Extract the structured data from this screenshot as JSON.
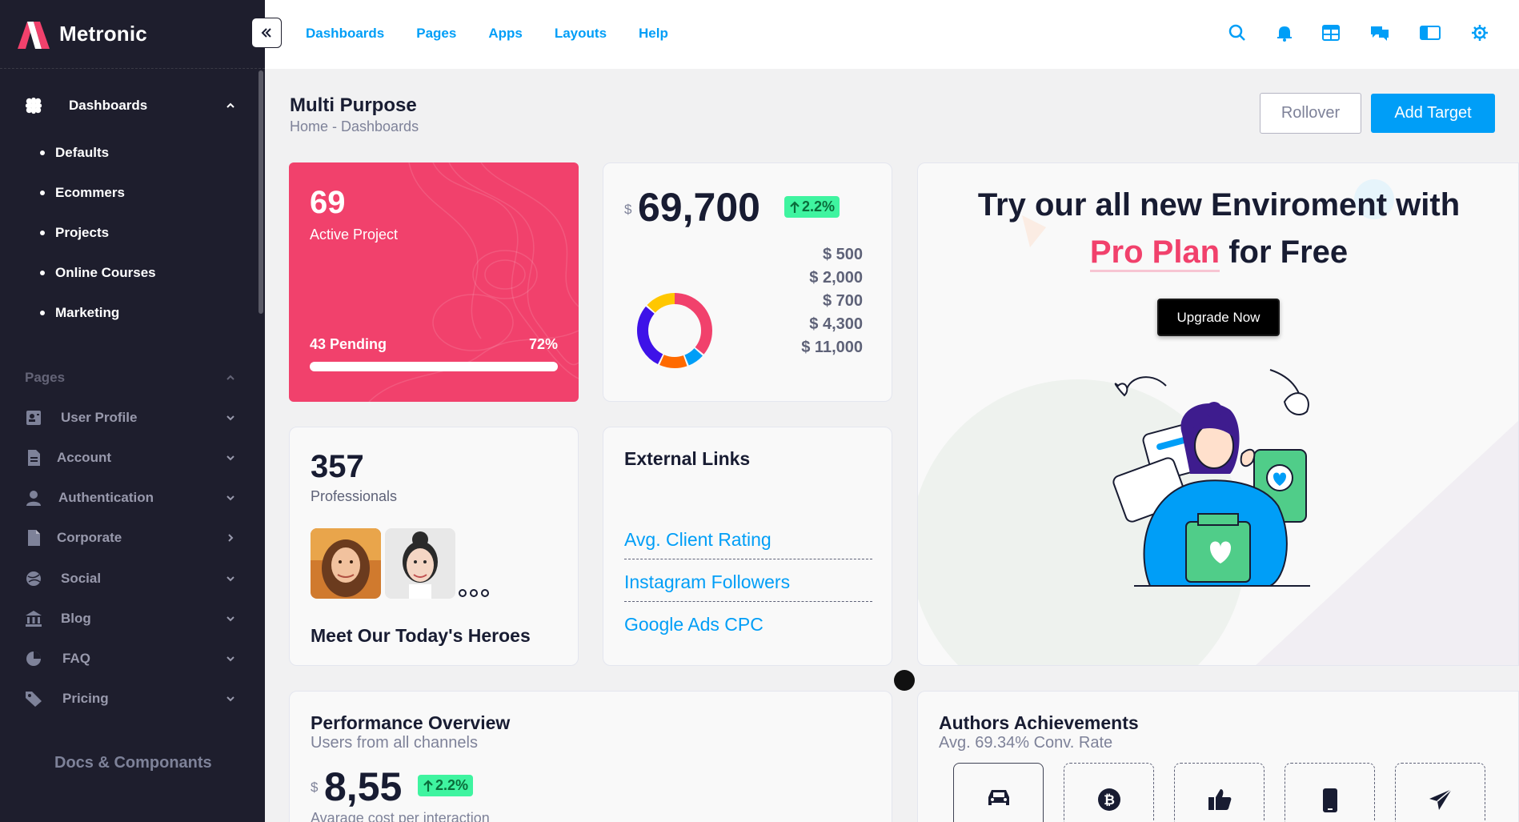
{
  "app": {
    "name": "Metronic"
  },
  "sidebar": {
    "dashboards_label": "Dashboards",
    "dashboard_items": [
      "Defaults",
      "Ecommers",
      "Projects",
      "Online Courses",
      "Marketing"
    ],
    "pages_section": "Pages",
    "pages_items": [
      {
        "label": "User Profile",
        "icon": "profile-icon"
      },
      {
        "label": "Account",
        "icon": "document-icon"
      },
      {
        "label": "Authentication",
        "icon": "user-icon"
      },
      {
        "label": "Corporate",
        "icon": "file-icon"
      },
      {
        "label": "Social",
        "icon": "globe-icon"
      },
      {
        "label": "Blog",
        "icon": "bank-icon"
      },
      {
        "label": "FAQ",
        "icon": "pie-icon"
      },
      {
        "label": "Pricing",
        "icon": "tag-icon"
      }
    ],
    "docs_label": "Docs & Componants"
  },
  "header": {
    "nav": [
      "Dashboards",
      "Pages",
      "Apps",
      "Layouts",
      "Help"
    ],
    "icons": [
      "search-icon",
      "bell-icon",
      "grid-icon",
      "chat-icon",
      "layout-icon",
      "settings-icon"
    ]
  },
  "page": {
    "title": "Multi Purpose",
    "breadcrumb": "Home - Dashboards",
    "rollover_label": "Rollover",
    "add_target_label": "Add Target"
  },
  "projects_card": {
    "value": "69",
    "label": "Active Project",
    "pending": "43 Pending",
    "percent": "72%",
    "progress": 0.72
  },
  "sales_card": {
    "currency": "$",
    "value": "69,700",
    "change": "2.2%",
    "values": [
      "$ 500",
      "$ 2,000",
      "$ 700",
      "$ 4,300",
      "$ 11,000"
    ],
    "donut_colors": [
      "#f1416c",
      "#009ef7",
      "#ff6a00",
      "#3e12e8",
      "#ffc700"
    ]
  },
  "promo": {
    "line1": "Try our all new Enviroment with",
    "highlight": "Pro Plan",
    "line2_rest": " for Free",
    "button": "Upgrade Now"
  },
  "heroes_card": {
    "value": "357",
    "label": "Professionals",
    "title": "Meet Our Today's Heroes"
  },
  "external_links": {
    "title": "External Links",
    "links": [
      "Avg. Client Rating",
      "Instagram Followers",
      "Google Ads CPC"
    ]
  },
  "performance": {
    "title": "Performance Overview",
    "subtitle": "Users from all channels",
    "currency": "$",
    "value": "8,55",
    "change": "2.2%",
    "footer": "Avarage cost per interaction"
  },
  "authors": {
    "title": "Authors Achievements",
    "subtitle": "Avg. 69.34% Conv. Rate",
    "tiles": [
      "car-icon",
      "bitcoin-icon",
      "thumbs-up-icon",
      "phone-icon",
      "send-icon"
    ]
  }
}
